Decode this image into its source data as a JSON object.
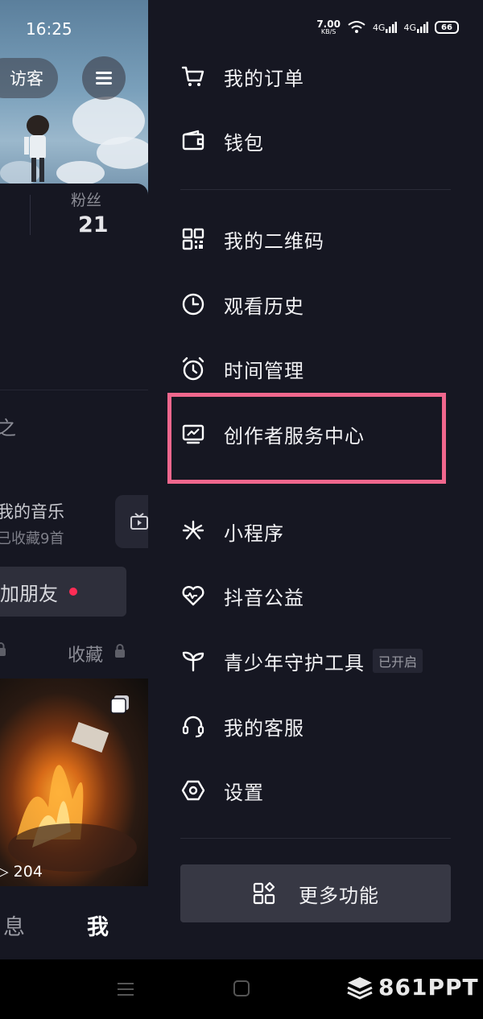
{
  "status_bar": {
    "time": "16:25",
    "net_speed_value": "7.00",
    "net_speed_unit": "KB/S",
    "signal1": "4G",
    "signal2": "4G",
    "battery": "66"
  },
  "profile_bg": {
    "visitor_button": "访客",
    "fans_label": "粉丝",
    "fans_count": "21",
    "partial_char": "之",
    "music_title": "我的音乐",
    "music_sub": "已收藏9首",
    "add_friend": "加朋友",
    "favorites_tab": "收藏",
    "play_count": "204",
    "tab_messages": "息",
    "tab_me": "我"
  },
  "drawer": {
    "items": [
      {
        "label": "我的订单",
        "icon": "cart-icon"
      },
      {
        "label": "钱包",
        "icon": "wallet-icon"
      },
      {
        "label": "我的二维码",
        "icon": "qrcode-icon"
      },
      {
        "label": "观看历史",
        "icon": "history-icon"
      },
      {
        "label": "时间管理",
        "icon": "alarm-icon"
      },
      {
        "label": "创作者服务中心",
        "icon": "creator-icon"
      },
      {
        "label": "小程序",
        "icon": "mini-program-icon"
      },
      {
        "label": "抖音公益",
        "icon": "charity-icon"
      },
      {
        "label": "青少年守护工具",
        "icon": "sprout-icon",
        "badge": "已开启"
      },
      {
        "label": "我的客服",
        "icon": "headset-icon"
      },
      {
        "label": "设置",
        "icon": "settings-icon"
      }
    ],
    "more_button": "更多功能",
    "highlight_color": "#f0678d"
  },
  "watermark": "861PPT"
}
